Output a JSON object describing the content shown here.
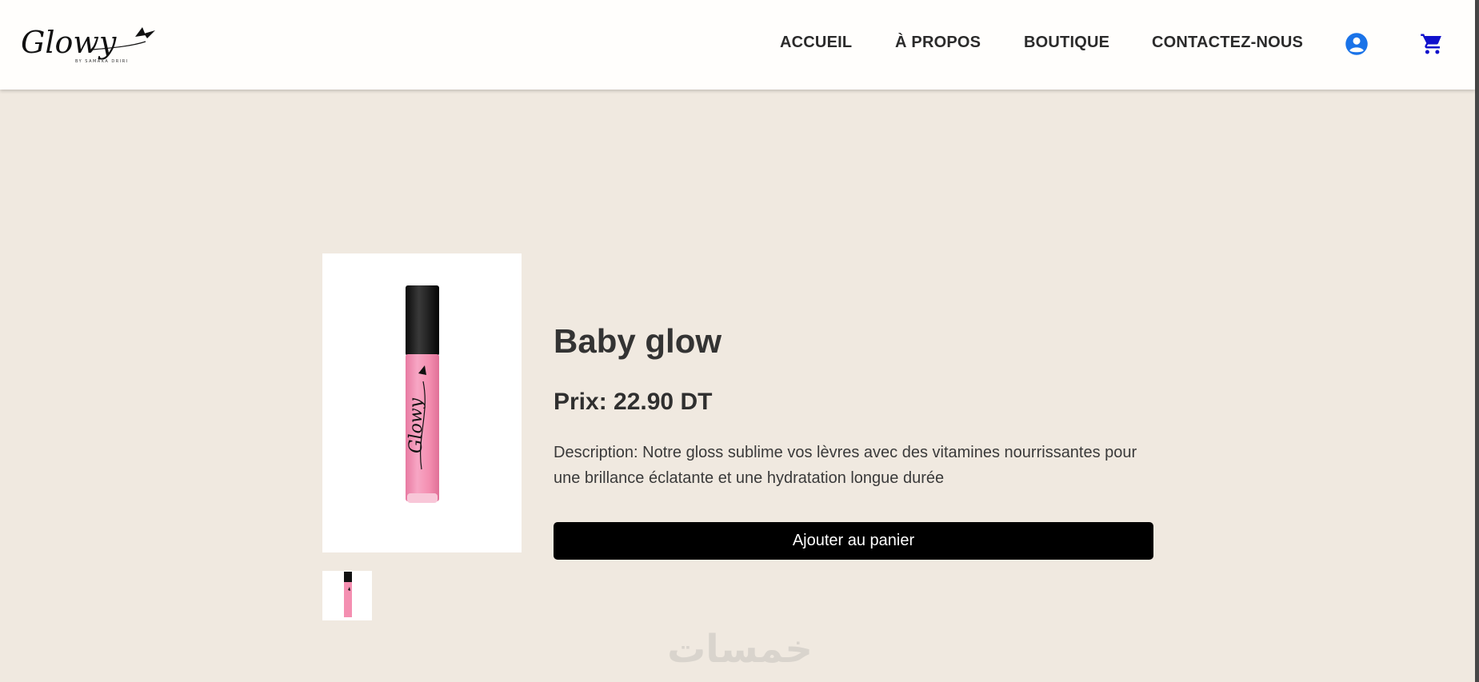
{
  "header": {
    "logo_text": "Glowy",
    "logo_subtext": "BY SAMAKA DRIRI",
    "nav": {
      "home": "ACCUEIL",
      "about": "À PROPOS",
      "shop": "BOUTIQUE",
      "contact": "CONTACTEZ-NOUS"
    },
    "icons": {
      "account": "account-circle-icon",
      "cart": "shopping-cart-icon"
    },
    "icon_color": "#1a73e8",
    "cart_color": "#1111cc"
  },
  "product": {
    "title": "Baby glow",
    "price": "Prix: 22.90 DT",
    "description": "Description: Notre gloss sublime vos lèvres avec des vitamines nourrissantes pour une brillance éclatante et une hydratation longue durée",
    "add_to_cart": "Ajouter au panier",
    "image_brand_text": "Glowy"
  },
  "watermark": {
    "text": "خمسات"
  },
  "colors": {
    "page_background": "#f0e9e0",
    "header_background": "#fffefc",
    "button_background": "#000000",
    "gloss_pink": "#f48fb1"
  }
}
